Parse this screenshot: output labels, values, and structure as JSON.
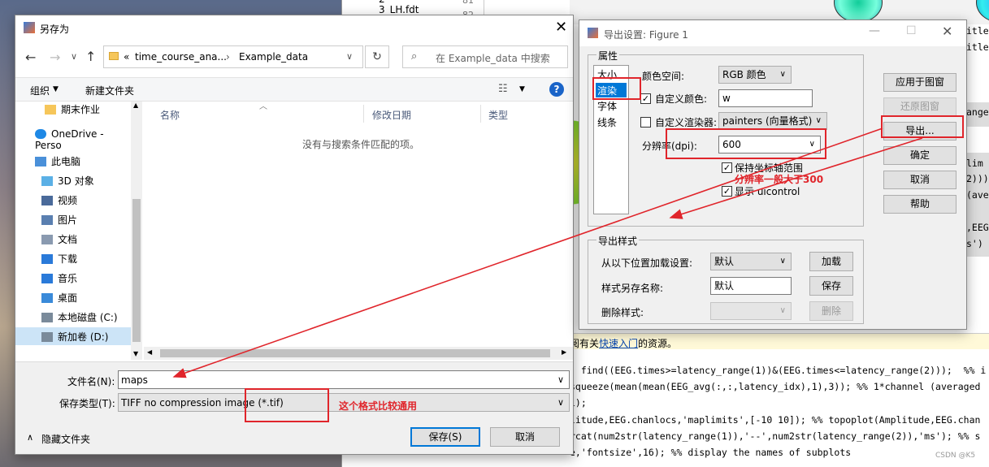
{
  "background_editor": {
    "file_list": {
      "partial_item": "2",
      "item": "3_LH.fdt",
      "line_nums": [
        "81",
        "82"
      ]
    },
    "right_partial": [
      "itle",
      "itle",
      "anged",
      "lim",
      "2)))",
      "(ave",
      ",EEG",
      "s')"
    ],
    "help_line": {
      "prefix": "阅有关",
      "link": "快速入门",
      "suffix": "的资源。"
    },
    "code_lines": [
      "  find((EEG.times>=latency_range(1))&(EEG.times<=latency_range(2)));  %% i",
      "squeeze(mean(mean(EEG_avg(:,:,latency_idx),1),3)); %% 1*channel (averaged",
      "i);",
      "litude,EEG.chanlocs,'maplimits',[-10 10]); %% topoplot(Amplitude,EEG.chan",
      "rcat(num2str(latency_range(1)),'--',num2str(latency_range(2)),'ms'); %% s",
      "e,'fontsize',16); %% display the names of subplots"
    ],
    "watermark": "CSDN @K5"
  },
  "save_dialog": {
    "title": "另存为",
    "path": {
      "prefix": "«",
      "crumb1": "time_course_ana...",
      "sep": "›",
      "crumb2": "Example_data"
    },
    "search_placeholder": "在 Example_data 中搜索",
    "toolbar": {
      "organize": "组织",
      "new_folder": "新建文件夹"
    },
    "nav_items": [
      {
        "label": "期末作业",
        "icon": "folder-icon"
      },
      {
        "label": "OneDrive - Perso",
        "icon": "cloud-icon"
      },
      {
        "label": "此电脑",
        "icon": "computer-icon"
      },
      {
        "label": "3D 对象",
        "icon": "cube-icon"
      },
      {
        "label": "视频",
        "icon": "video-icon"
      },
      {
        "label": "图片",
        "icon": "picture-icon"
      },
      {
        "label": "文档",
        "icon": "document-icon"
      },
      {
        "label": "下载",
        "icon": "download-icon"
      },
      {
        "label": "音乐",
        "icon": "music-icon"
      },
      {
        "label": "桌面",
        "icon": "desktop-icon"
      },
      {
        "label": "本地磁盘 (C:)",
        "icon": "drive-icon"
      },
      {
        "label": "新加卷 (D:)",
        "icon": "drive-icon"
      }
    ],
    "columns": {
      "name": "名称",
      "date": "修改日期",
      "type": "类型"
    },
    "empty_message": "没有与搜索条件匹配的项。",
    "filename_label": "文件名(N):",
    "filename_value": "maps",
    "filetype_label": "保存类型(T):",
    "filetype_value": "TIFF no compression image (*.tif)",
    "hide_folders": "隐藏文件夹",
    "save_button": "保存(S)",
    "cancel_button": "取消"
  },
  "export_dialog": {
    "title": "导出设置: Figure 1",
    "properties_group": "属性",
    "prop_list": [
      "大小",
      "渲染",
      "字体",
      "线条"
    ],
    "colorspace_label": "颜色空间:",
    "colorspace_value": "RGB 颜色",
    "custom_color_label": "自定义颜色:",
    "custom_color_checked": true,
    "custom_color_value": "w",
    "custom_renderer_label": "自定义渲染器:",
    "custom_renderer_checked": false,
    "renderer_value": "painters (向量格式)",
    "resolution_label": "分辨率(dpi):",
    "resolution_value": "600",
    "keep_axes_label": "保持坐标轴范围",
    "keep_axes_checked": true,
    "show_ui_label": "显示 uicontrol",
    "show_ui_checked": true,
    "style_group": "导出样式",
    "load_label": "从以下位置加载设置:",
    "load_value": "默认",
    "load_button": "加载",
    "save_as_label": "样式另存名称:",
    "save_as_value": "默认",
    "save_button": "保存",
    "delete_label": "删除样式:",
    "delete_value": "",
    "delete_button": "删除",
    "side_buttons": {
      "apply": "应用于图窗",
      "restore": "还原图窗",
      "export": "导出...",
      "ok": "确定",
      "cancel": "取消",
      "help": "帮助"
    }
  },
  "annotations": {
    "dpi_note": "分辨率一般大于300",
    "format_note": "这个格式比较通用",
    "color": "#e0252b"
  }
}
